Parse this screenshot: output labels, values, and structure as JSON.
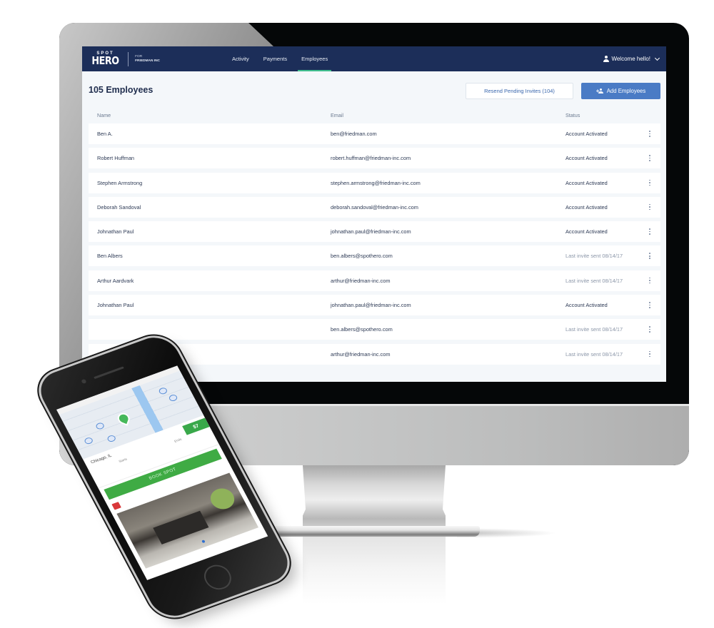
{
  "app": {
    "brand_top": "SPOT",
    "brand_bottom": "HERO",
    "for_label": "FOR",
    "company": "FRIEDMAN INC"
  },
  "nav": {
    "tabs": [
      {
        "label": "Activity",
        "active": false
      },
      {
        "label": "Payments",
        "active": false
      },
      {
        "label": "Employees",
        "active": true
      }
    ],
    "user_menu": "Welcome hello!",
    "active_tab_color": "#3fbf8e"
  },
  "page": {
    "title": "105 Employees",
    "resend_button": "Resend Pending Invites (104)",
    "add_button": "Add Employees"
  },
  "table": {
    "columns": [
      "Name",
      "Email",
      "Status"
    ],
    "rows": [
      {
        "name": "Ben A.",
        "email": "ben@friedman.com",
        "status": "Account Activated",
        "pending": false
      },
      {
        "name": "Robert Huffman",
        "email": "robert.huffman@friedman-inc.com",
        "status": "Account Activated",
        "pending": false
      },
      {
        "name": "Stephen Armstrong",
        "email": "stephen.armstrong@friedman-inc.com",
        "status": "Account Activated",
        "pending": false
      },
      {
        "name": "Deborah Sandoval",
        "email": "deborah.sandoval@friedman-inc.com",
        "status": "Account Activated",
        "pending": false
      },
      {
        "name": "Johnathan Paul",
        "email": "johnathan.paul@friedman-inc.com",
        "status": "Account Activated",
        "pending": false
      },
      {
        "name": "Ben Albers",
        "email": "ben.albers@spothero.com",
        "status": "Last invite sent 08/14/17",
        "pending": true
      },
      {
        "name": "Arthur Aardvark",
        "email": "arthur@friedman-inc.com",
        "status": "Last invite sent 08/14/17",
        "pending": true
      },
      {
        "name": "Johnathan Paul",
        "email": "johnathan.paul@friedman-inc.com",
        "status": "Account Activated",
        "pending": false
      },
      {
        "name": "",
        "email": "ben.albers@spothero.com",
        "status": "Last invite sent 08/14/17",
        "pending": true
      },
      {
        "name": "",
        "email": "arthur@friedman-inc.com",
        "status": "Last invite sent 08/14/17",
        "pending": true
      }
    ]
  },
  "colors": {
    "navbar": "#1c2e59",
    "primary_button": "#4a7bc5",
    "link_text": "#3a67ad",
    "page_background": "#f4f7fa"
  },
  "phone": {
    "price": "$7",
    "address": "Chicago, IL",
    "starts_label": "Starts",
    "ends_label": "Ends",
    "book_button": "BOOK SPOT",
    "book_color": "#3fab44"
  }
}
